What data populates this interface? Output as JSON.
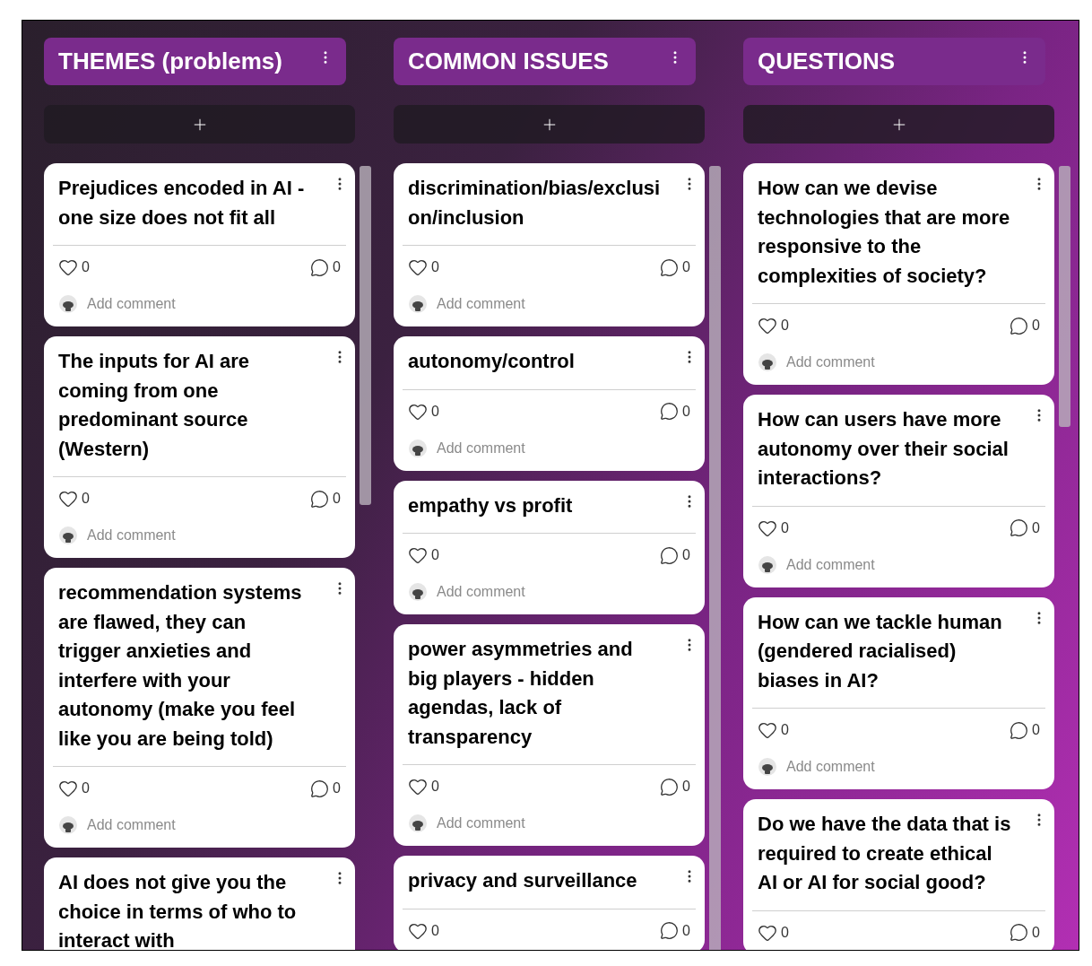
{
  "columns": [
    {
      "title": "THEMES (problems)",
      "cards": [
        {
          "text": "Prejudices encoded in AI - one size does not fit all",
          "likes": "0",
          "comments": "0",
          "comment_placeholder": "Add comment"
        },
        {
          "text": "The inputs for AI are coming from one predominant source (Western)",
          "likes": "0",
          "comments": "0",
          "comment_placeholder": "Add comment"
        },
        {
          "text": "recommendation systems are flawed, they can trigger anxieties and interfere with your autonomy  (make you feel like you are being told)",
          "likes": "0",
          "comments": "0",
          "comment_placeholder": "Add comment"
        },
        {
          "text": "AI does not give you the choice in terms of who to interact with"
        }
      ]
    },
    {
      "title": "COMMON ISSUES",
      "cards": [
        {
          "text": "discrimination/bias/exclusi on/inclusion",
          "likes": "0",
          "comments": "0",
          "comment_placeholder": "Add comment"
        },
        {
          "text": "autonomy/control",
          "likes": "0",
          "comments": "0",
          "comment_placeholder": "Add comment"
        },
        {
          "text": "empathy vs profit",
          "likes": "0",
          "comments": "0",
          "comment_placeholder": "Add comment"
        },
        {
          "text": "power asymmetries and big players - hidden agendas, lack of transparency",
          "likes": "0",
          "comments": "0",
          "comment_placeholder": "Add comment"
        },
        {
          "text": "privacy and surveillance",
          "likes": "0",
          "comments": "0"
        }
      ]
    },
    {
      "title": "QUESTIONS",
      "cards": [
        {
          "text": "How can we devise technologies that are more responsive to the complexities of society?",
          "likes": "0",
          "comments": "0",
          "comment_placeholder": "Add comment"
        },
        {
          "text": "How can users have more autonomy over their social interactions?",
          "likes": "0",
          "comments": "0",
          "comment_placeholder": "Add comment"
        },
        {
          "text": "How can we tackle human (gendered racialised) biases in AI?",
          "likes": "0",
          "comments": "0",
          "comment_placeholder": "Add comment"
        },
        {
          "text": "Do we have the data that is required to create ethical AI or AI for social good?",
          "likes": "0",
          "comments": "0"
        }
      ]
    }
  ]
}
